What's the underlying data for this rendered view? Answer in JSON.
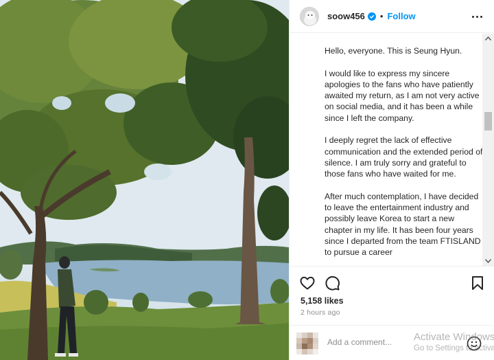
{
  "post": {
    "username": "soow456",
    "verified": true,
    "separator": "•",
    "follow_label": "Follow",
    "more_icon": "more-horizontal-icon"
  },
  "caption": {
    "paragraphs": [
      "Hello, everyone. This is Seung Hyun.",
      "I would like to express my sincere apologies to the fans who have patiently awaited my return, as I am not very active on social media, and it has been a while since I left the company.",
      "I deeply regret the lack of effective communication and the extended period of silence. I am truly sorry and grateful to those fans who have waited for me.",
      "After much contemplation, I have decided to leave the entertainment industry and possibly leave Korea to start a new chapter in my life. It has been four years since I departed from the team FTISLAND to pursue a career"
    ]
  },
  "actions": {
    "like_icon": "heart-icon",
    "comment_icon": "comment-icon",
    "save_icon": "bookmark-icon",
    "likes": "5,158 likes",
    "time": "2 hours ago"
  },
  "comment": {
    "placeholder": "Add a comment...",
    "emoji_icon": "emoji-icon"
  },
  "watermark": {
    "title": "Activate Windows",
    "subtitle": "Go to Settings to activate Windows."
  },
  "colors": {
    "accent": "#0095f6",
    "text": "#262626",
    "muted": "#8e8e8e"
  }
}
